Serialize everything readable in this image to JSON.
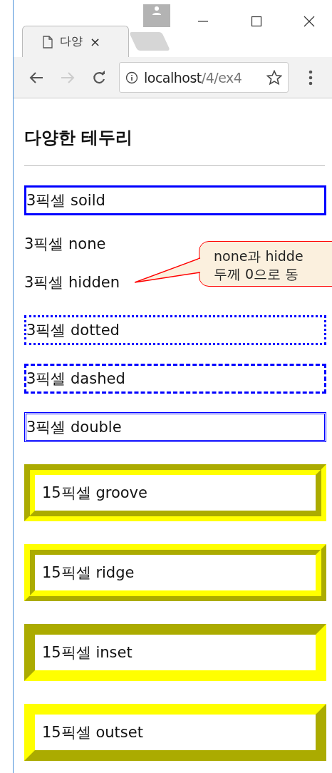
{
  "browser": {
    "tab": {
      "title": "다양",
      "close": "×",
      "selected": true
    },
    "address": {
      "host": "localhost",
      "path": "/4/ex4"
    }
  },
  "page": {
    "heading": "다양한 테두리",
    "items": [
      {
        "kind": "solid",
        "text": "3픽셀 soild"
      },
      {
        "kind": "none",
        "text": "3픽셀 none"
      },
      {
        "kind": "hidden",
        "text": "3픽셀 hidden"
      },
      {
        "kind": "dotted",
        "text": "3픽셀 dotted"
      },
      {
        "kind": "dashed",
        "text": "3픽셀 dashed"
      },
      {
        "kind": "double",
        "text": "3픽셀 double"
      },
      {
        "kind": "groove",
        "text": "15픽셀 groove"
      },
      {
        "kind": "ridge",
        "text": "15픽셀 ridge"
      },
      {
        "kind": "inset",
        "text": "15픽셀 inset"
      },
      {
        "kind": "outset",
        "text": "15픽셀 outset"
      }
    ],
    "callout": {
      "lines": [
        "none과 hidde",
        "두께 0으로 동"
      ]
    }
  }
}
